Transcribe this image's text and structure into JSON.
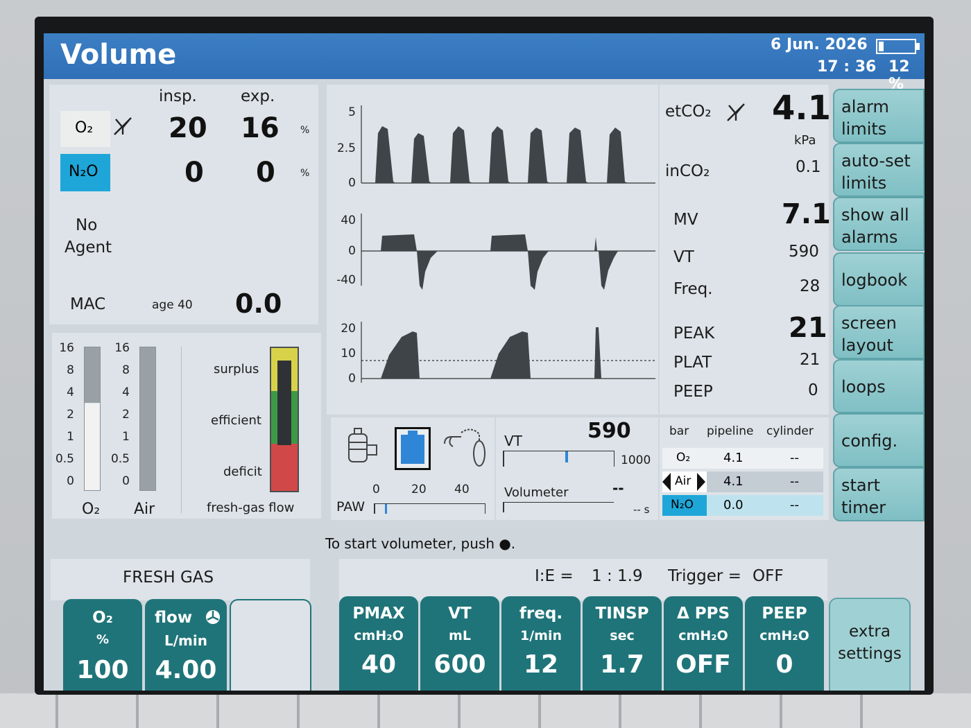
{
  "header": {
    "mode": "Volume",
    "date": "6 Jun. 2026",
    "time": "17 : 36",
    "battery_percent": "12 %"
  },
  "gas": {
    "col_insp": "insp.",
    "col_exp": "exp.",
    "pct": "%",
    "o2": {
      "label": "O₂",
      "insp": "20",
      "exp": "16"
    },
    "n2o": {
      "label": "N₂O",
      "insp": "0",
      "exp": "0"
    },
    "agent": {
      "line1": "No",
      "line2": "Agent"
    },
    "mac": {
      "label": "MAC",
      "age": "age 40",
      "value": "0.0"
    }
  },
  "flowmeter": {
    "ticks": [
      "16",
      "8",
      "4",
      "2",
      "1",
      "0.5",
      "0"
    ],
    "o2_label": "O₂",
    "air_label": "Air",
    "o2_level": 0.6,
    "air_level": 0.0,
    "fresh": {
      "surplus": "surplus",
      "efficient": "efficient",
      "deficit": "deficit",
      "label": "fresh-gas flow"
    }
  },
  "waves": {
    "co2_ticks": [
      "5",
      "2.5",
      "0"
    ],
    "flow_ticks": [
      "40",
      "0",
      "-40"
    ],
    "paw_ticks": [
      "20",
      "10",
      "0"
    ]
  },
  "values": {
    "etco2": {
      "label": "etCO₂",
      "value": "4.1",
      "unit": "kPa"
    },
    "inco2": {
      "label": "inCO₂",
      "value": "0.1"
    },
    "mv": {
      "label": "MV",
      "value": "7.1"
    },
    "vt": {
      "label": "VT",
      "value": "590"
    },
    "freq": {
      "label": "Freq.",
      "value": "28"
    },
    "peak": {
      "label": "PEAK",
      "value": "21"
    },
    "plat": {
      "label": "PLAT",
      "value": "21"
    },
    "peep": {
      "label": "PEEP",
      "value": "0"
    }
  },
  "menu": [
    {
      "line1": "alarm",
      "line2": "limits"
    },
    {
      "line1": "auto-set",
      "line2": "limits"
    },
    {
      "line1": "show all",
      "line2": "alarms"
    },
    {
      "line1": "logbook",
      "line2": ""
    },
    {
      "line1": "screen",
      "line2": "layout"
    },
    {
      "line1": "loops",
      "line2": ""
    },
    {
      "line1": "config.",
      "line2": ""
    },
    {
      "line1": "start",
      "line2": "timer"
    }
  ],
  "mini": {
    "paw_label": "PAW",
    "paw_ticks": [
      "0",
      "20",
      "40"
    ],
    "vt_label": "VT",
    "vt_value": "590",
    "vt_max": "1000",
    "volumeter_label": "Volumeter",
    "volumeter_value": "--",
    "volumeter_time": "-- s"
  },
  "supply": {
    "headers": [
      "bar",
      "pipeline",
      "cylinder"
    ],
    "rows": [
      {
        "gas": "O₂",
        "pipeline": "4.1",
        "cylinder": "--"
      },
      {
        "gas": "Air",
        "pipeline": "4.1",
        "cylinder": "--"
      },
      {
        "gas": "N₂O",
        "pipeline": "0.0",
        "cylinder": "--"
      }
    ]
  },
  "message": "To start volumeter, push ●.",
  "fresh_gas": {
    "title": "FRESH GAS",
    "o2": {
      "label": "O₂",
      "unit": "%",
      "value": "100"
    },
    "flow": {
      "label": "flow",
      "unit": "L/min",
      "value": "4.00"
    }
  },
  "ventilation": {
    "ie_label": "I:E =",
    "ie_value": "1 : 1.9",
    "trigger_label": "Trigger =",
    "trigger_value": "OFF",
    "params": [
      {
        "label": "PMAX",
        "unit": "cmH₂O",
        "value": "40"
      },
      {
        "label": "VT",
        "unit": "mL",
        "value": "600"
      },
      {
        "label": "freq.",
        "unit": "1/min",
        "value": "12"
      },
      {
        "label": "TINSP",
        "unit": "sec",
        "value": "1.7"
      },
      {
        "label": "Δ PPS",
        "unit": "cmH₂O",
        "value": "OFF"
      },
      {
        "label": "PEEP",
        "unit": "cmH₂O",
        "value": "0"
      }
    ],
    "extra": {
      "line1": "extra",
      "line2": "settings"
    }
  }
}
